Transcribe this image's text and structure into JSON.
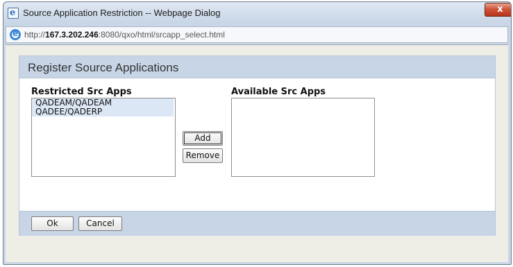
{
  "window": {
    "title": "Source Application Restriction -- Webpage Dialog",
    "close_label": "x",
    "url_prefix": "http://",
    "url_host": "167.3.202.246",
    "url_rest": ":8080/qxo/html/srcapp_select.html"
  },
  "panel": {
    "title": "Register Source Applications"
  },
  "restricted": {
    "label": "Restricted Src Apps",
    "items": [
      "QADEAM/QADEAM",
      "QADEE/QADERP"
    ]
  },
  "available": {
    "label": "Available Src Apps",
    "items": []
  },
  "buttons": {
    "add": "Add",
    "remove": "Remove",
    "ok": "Ok",
    "cancel": "Cancel"
  },
  "icons": {
    "title_icon": "webpage-dialog-icon",
    "address_icon": "internet-explorer-icon"
  }
}
